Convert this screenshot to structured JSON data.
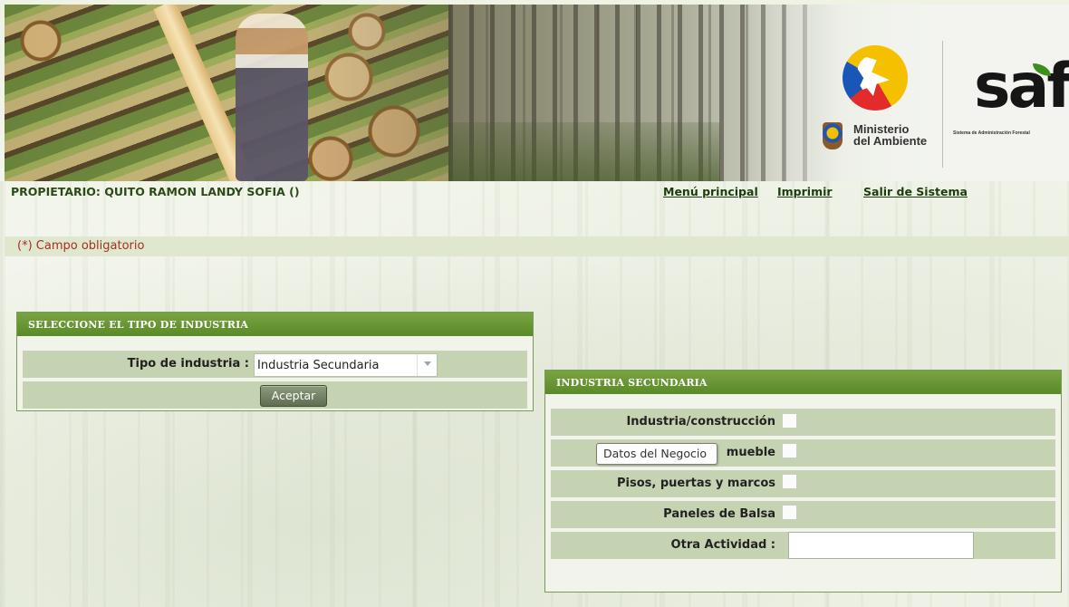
{
  "banner": {
    "ministry_line1": "Ministerio",
    "ministry_line2": "del Ambiente",
    "saf_logo": "saf",
    "saf_subtitle": "Sistema de Administración Forestal"
  },
  "header": {
    "owner": "PROPIETARIO: QUITO RAMON LANDY SOFIA ()",
    "nav": {
      "main_menu": "Menú principal",
      "print": "Imprimir",
      "exit": "Salir de Sistema"
    }
  },
  "required_note": "(*) Campo obligatorio",
  "industry_type_panel": {
    "title": "SELECCIONE EL TIPO DE INDUSTRIA",
    "field_label": "Tipo de industria :",
    "selected_value": "Industria Secundaria",
    "accept_label": "Aceptar"
  },
  "secondary_panel": {
    "title": "INDUSTRIA SECUNDARIA",
    "options": [
      {
        "label": "Industria/construcción",
        "checked": false
      },
      {
        "label": "mueble",
        "checked": false
      },
      {
        "label": "Pisos, puertas y marcos",
        "checked": false
      },
      {
        "label": "Paneles de Balsa",
        "checked": false
      }
    ],
    "other_label": "Otra Actividad :",
    "other_value": "",
    "tooltip": "Datos del Negocio"
  },
  "colors": {
    "panel_header": "#6a9636",
    "row_bg": "#c6d3b2",
    "owner_text": "#2c4a18",
    "required_text": "#a4301d"
  }
}
